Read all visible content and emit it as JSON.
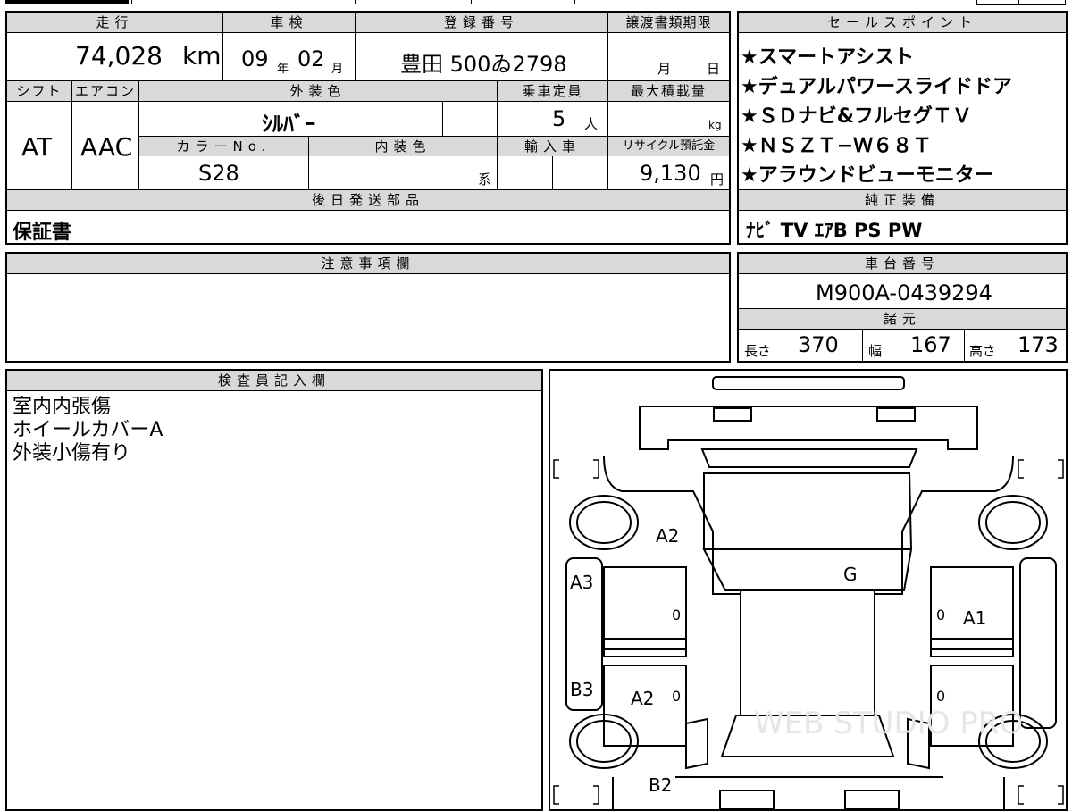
{
  "top_table": {
    "headers": {
      "mileage": "走行",
      "inspection": "車検",
      "registration": "登録番号",
      "transfer_deadline": "譲渡書類期限",
      "shift": "シフト",
      "aircon": "エアコン",
      "exterior_color": "外装色",
      "capacity": "乗車定員",
      "max_load": "最大積載量",
      "color_no": "カラーNo.",
      "interior_color": "内装色",
      "import": "輸入車",
      "recycle_fee": "リサイクル預託金",
      "later_parts": "後日発送部品"
    },
    "mileage_value": "74,028",
    "mileage_unit": "km",
    "inspection_year": "09",
    "year_label": "年",
    "inspection_month": "02",
    "month_label": "月",
    "registration_value": "豊田 500ゐ2798",
    "deadline_month_label": "月",
    "deadline_day_label": "日",
    "shift_value": "AT",
    "aircon_value": "AAC",
    "exterior_color_value": "ｼﾙﾊﾞｰ",
    "capacity_value": "5",
    "capacity_unit": "人",
    "max_load_unit": "kg",
    "color_no_value": "S28",
    "interior_suffix": "系",
    "recycle_value": "9,130",
    "recycle_unit": "円",
    "later_parts_value": "保証書"
  },
  "sales_points": {
    "header": "セールスポイント",
    "items": [
      "★スマートアシスト",
      "★デュアルパワースライドドア",
      "★ＳＤナビ&フルセグＴＶ",
      "★ＮＳＺＴ−Ｗ６８Ｔ",
      "★アラウンドビューモニター"
    ]
  },
  "genuine_equipment": {
    "header": "純正装備",
    "value": "ﾅﾋﾞ TV ｴｱB PS PW"
  },
  "notes": {
    "header": "注意事項欄",
    "value": ""
  },
  "chassis": {
    "header": "車台番号",
    "value": "M900A-0439294"
  },
  "specs": {
    "header": "諸元",
    "length_label": "長さ",
    "length_value": "370",
    "width_label": "幅",
    "width_value": "167",
    "height_label": "高さ",
    "height_value": "173"
  },
  "inspector": {
    "header": "検査員記入欄",
    "lines": [
      "室内内張傷",
      "ホイールカバーA",
      "外装小傷有り"
    ]
  },
  "diagram": {
    "marks": {
      "a2_upper": "A2",
      "g": "G",
      "a3": "A3",
      "a1": "A1",
      "b3": "B3",
      "a2_lower": "A2",
      "b2": "B2",
      "zero_left_upper": "0",
      "zero_right_upper": "0",
      "zero_left_lower": "0",
      "zero_right_lower": "0"
    },
    "watermark": "WEB STUDIO PRO"
  }
}
